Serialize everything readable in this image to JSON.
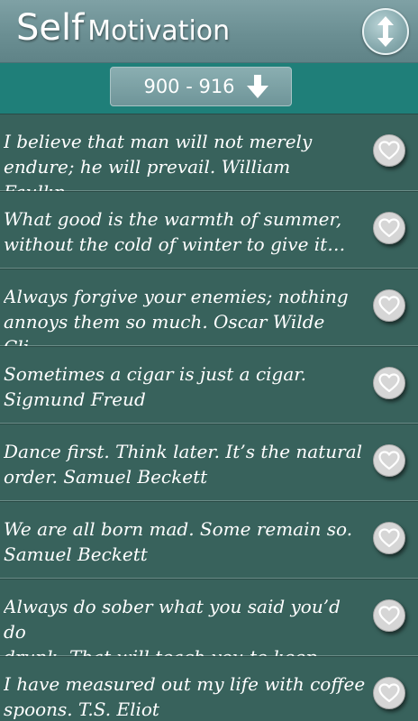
{
  "header": {
    "title_big": "Self",
    "title_small": "Motivation"
  },
  "range": {
    "label": "900 - 916"
  },
  "icons": {
    "sort": "up-down-arrows-icon",
    "range": "arrow-down-icon",
    "favorite": "heart-outline-icon"
  },
  "colors": {
    "header": "#6b8f93",
    "range_bar": "#1f7f79",
    "list_bg": "#38625c"
  },
  "quotes": [
    "I believe that man will not merely\nendure; he will prevail. William Faulkn…",
    "What good is the warmth of summer,\nwithout the cold of winter to give it…",
    "Always forgive your enemies; nothing\nannoys them so much. Oscar Wilde Cli…",
    "Sometimes a cigar is just a cigar.\nSigmund Freud",
    "Dance first. Think later. It’s the natural\norder. Samuel Beckett",
    "We are all born mad. Some remain so.\nSamuel Beckett",
    "Always do sober what you said you’d do\ndrunk. That will teach you to keep your…",
    "I have measured out my life with coffee\nspoons. T.S. Eliot"
  ]
}
